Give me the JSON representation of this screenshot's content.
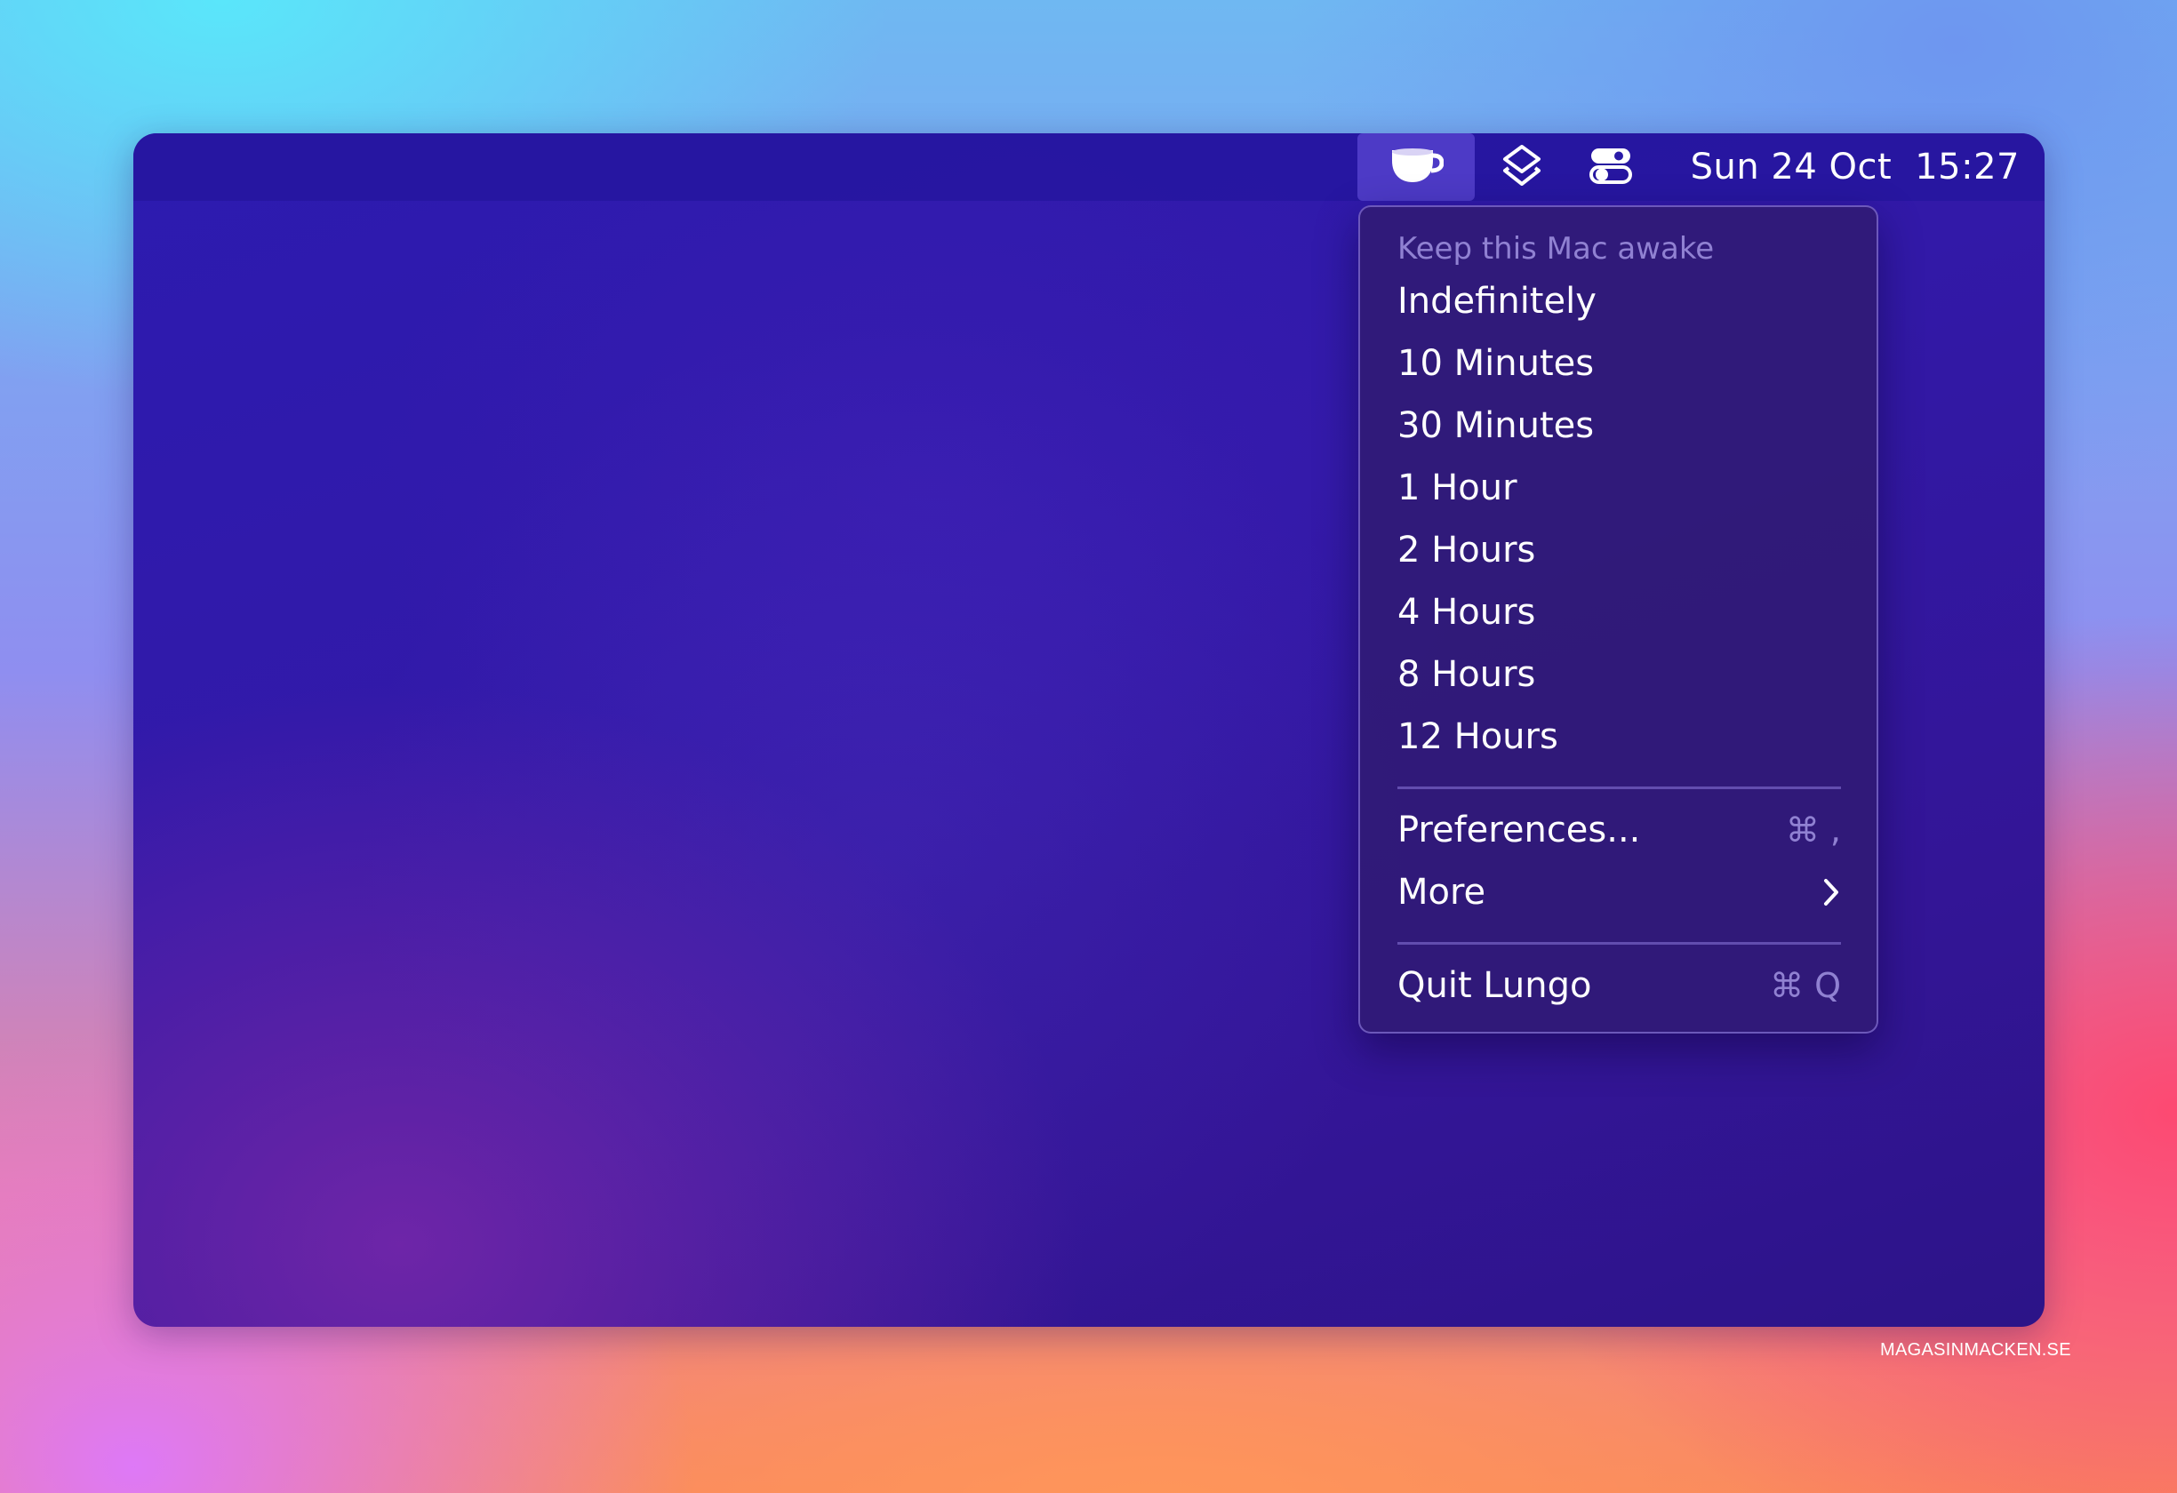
{
  "menubar": {
    "icons": [
      "coffee-cup-icon",
      "layers-icon",
      "control-center-icon"
    ],
    "date": "Sun 24 Oct",
    "time": "15:27"
  },
  "menu": {
    "header": "Keep this Mac awake",
    "durations": [
      "Indefinitely",
      "10 Minutes",
      "30 Minutes",
      "1 Hour",
      "2 Hours",
      "4 Hours",
      "8 Hours",
      "12 Hours"
    ],
    "preferences": {
      "label": "Preferences...",
      "shortcut_symbol": "⌘",
      "shortcut_key": ","
    },
    "more": {
      "label": "More",
      "icon": "chevron-right-icon"
    },
    "quit": {
      "label": "Quit Lungo",
      "shortcut_symbol": "⌘",
      "shortcut_key": "Q"
    }
  },
  "watermark": "MAGASINMACKEN.SE"
}
